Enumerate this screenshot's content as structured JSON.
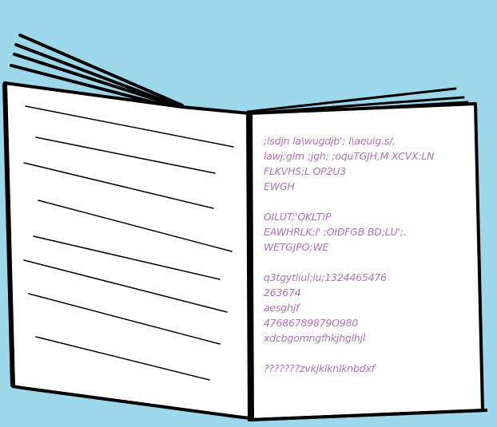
{
  "book": {
    "background_color": "#9dd8ea",
    "page_color": "#ffffff",
    "ink_color": "#000000",
    "text_color": "#b46fc0",
    "right_page": {
      "paragraphs": [
        {
          "lines": [
            ";lsdjn  la\\wugdjb';  l\\aeuig.s/,",
            "lawj;glm  ;jgh; ;oquTGJH,M XCVX:LN",
            "FLKVHS;L OP2U3",
            "EWGH"
          ]
        },
        {
          "lines": [
            "OILUT;'QKLTIP",
            "EAWHRLK;l'  ;OIDFGB BD;LU';.",
            "WETGJPO;WE"
          ]
        },
        {
          "lines": [
            "q3tgytliul;iu;1324465476",
            "263674",
            "aesghjf",
            "47686789879O980",
            "xdcbgomngfhkjhglhjl"
          ]
        },
        {
          "lines": [
            "???????zvkjklknlknbdxf"
          ]
        }
      ]
    }
  }
}
